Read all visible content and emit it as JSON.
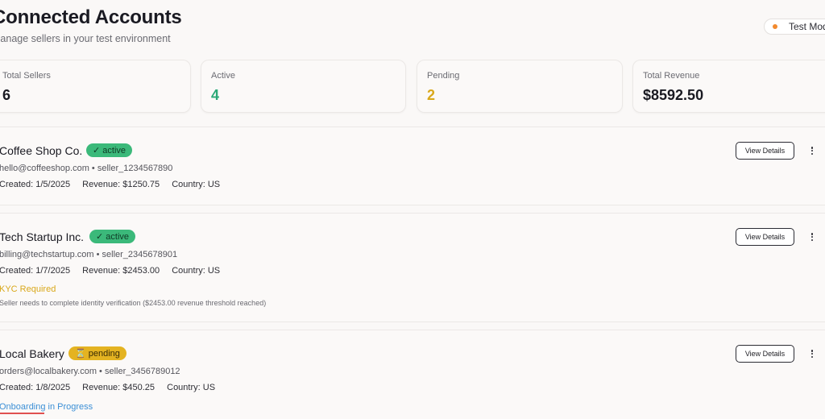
{
  "header": {
    "title": "Connected Accounts",
    "subtitle": "Manage sellers in your test environment",
    "mode_label": "Test Mode"
  },
  "stats": [
    {
      "label": "Total Sellers",
      "value": "6"
    },
    {
      "label": "Active",
      "value": "4"
    },
    {
      "label": "Pending",
      "value": "2"
    },
    {
      "label": "Total Revenue",
      "value": "$8592.50"
    }
  ],
  "colors": {
    "active": "#2aa876",
    "pending": "#d9a81a",
    "accent_orange": "#f28a2e",
    "link_blue": "#3b8fd6"
  },
  "accounts": [
    {
      "name": "Coffee Shop Co.",
      "status": "✓ active",
      "contact": "hello@coffeeshop.com • seller_1234567890",
      "created": "Created: 1/5/2025",
      "revenue": "Revenue: $1250.75",
      "country": "Country: US",
      "button": "View Details"
    },
    {
      "name": "Tech Startup Inc.",
      "status": "✓ active",
      "contact": "billing@techstartup.com • seller_2345678901",
      "created": "Created: 1/7/2025",
      "revenue": "Revenue: $2453.00",
      "country": "Country: US",
      "note_title": "KYC Required",
      "note_text": "Seller needs to complete identity verification ($2453.00 revenue threshold reached)",
      "button": "View Details"
    },
    {
      "name": "Local Bakery",
      "status": "⏳ pending",
      "contact": "orders@localbakery.com • seller_3456789012",
      "created": "Created: 1/8/2025",
      "revenue": "Revenue: $450.25",
      "country": "Country: US",
      "note_title": "Onboarding in Progress",
      "button": "View Details"
    }
  ]
}
